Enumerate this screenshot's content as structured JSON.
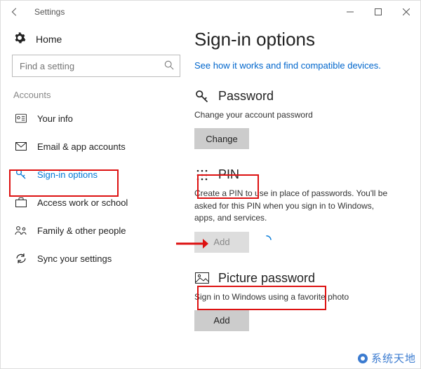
{
  "window": {
    "title": "Settings"
  },
  "home_label": "Home",
  "search": {
    "placeholder": "Find a setting"
  },
  "section_label": "Accounts",
  "nav": {
    "your_info": "Your info",
    "email": "Email & app accounts",
    "signin": "Sign-in options",
    "work": "Access work or school",
    "family": "Family & other people",
    "sync": "Sync your settings"
  },
  "page": {
    "title": "Sign-in options",
    "link": "See how it works and find compatible devices."
  },
  "password": {
    "heading": "Password",
    "desc": "Change your account password",
    "button": "Change"
  },
  "pin": {
    "heading": "PIN",
    "desc": "Create a PIN to use in place of passwords. You'll be asked for this PIN when you sign in to Windows, apps, and services.",
    "button": "Add"
  },
  "picture": {
    "heading": "Picture password",
    "desc": "Sign in to Windows using a favorite photo",
    "button": "Add"
  },
  "watermark": "系统天地"
}
